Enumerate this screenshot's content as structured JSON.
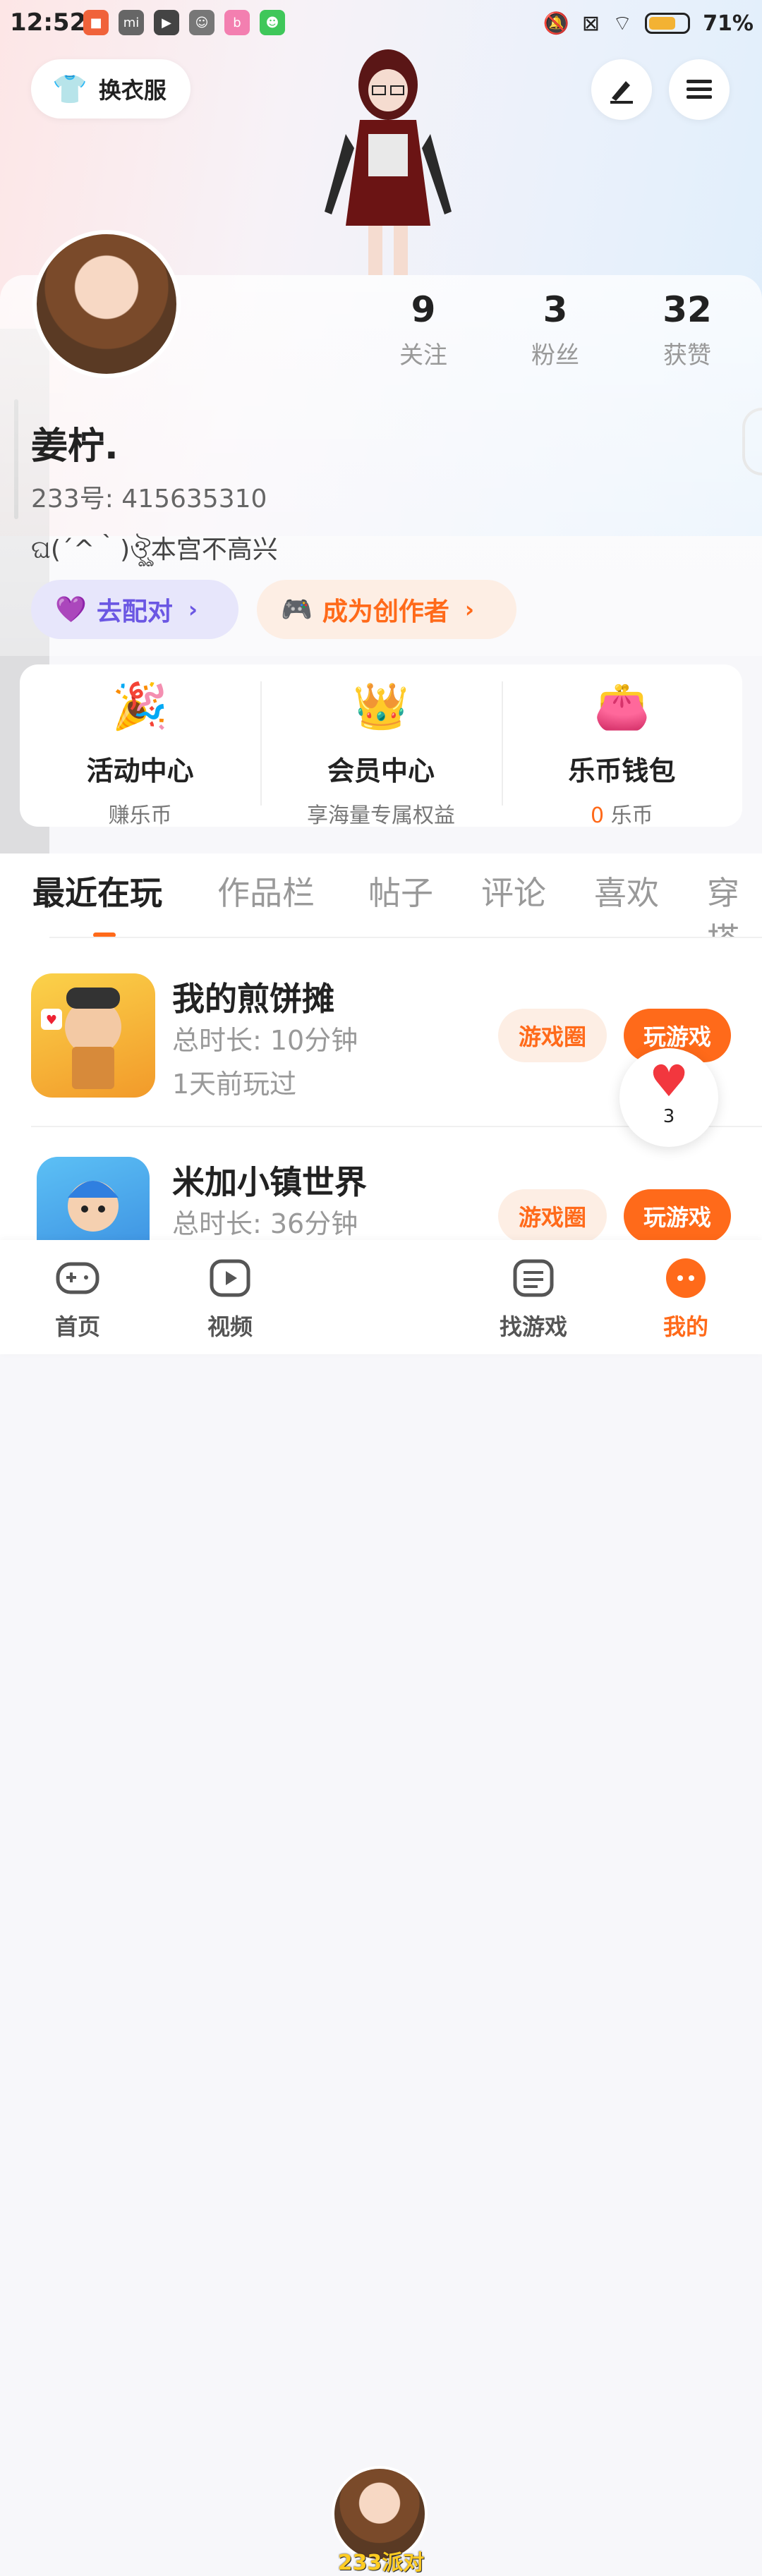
{
  "status_bar": {
    "time": "12:52",
    "battery": "71%",
    "battery_level": 0.71
  },
  "header": {
    "outfit_label": "换衣服",
    "edit_icon": "pen-icon",
    "menu_icon": "menu-icon"
  },
  "profile": {
    "username": "姜柠.",
    "id_text": "233号: 415635310",
    "signature": "ଘ(´^｀)ঔৣ本宫不高兴",
    "stats": [
      {
        "num": "9",
        "label": "关注"
      },
      {
        "num": "3",
        "label": "粉丝"
      },
      {
        "num": "32",
        "label": "获赞"
      }
    ],
    "pair_button": "去配对",
    "creator_button": "成为创作者"
  },
  "features": [
    {
      "title": "活动中心",
      "sub": "赚乐币",
      "icon": "party-popper-icon"
    },
    {
      "title": "会员中心",
      "sub": "享海量专属权益",
      "icon": "crown-icon"
    },
    {
      "title": "乐币钱包",
      "sub_accent": "0",
      "sub": " 乐币",
      "icon": "wallet-icon"
    }
  ],
  "tabs": [
    "最近在玩",
    "作品栏",
    "帖子",
    "评论",
    "喜欢",
    "穿搭"
  ],
  "active_tab": "最近在玩",
  "games": [
    {
      "name": "我的煎饼摊",
      "time": "总时长: 10分钟",
      "last": "1天前玩过",
      "circle_btn": "游戏圈",
      "play_btn": "玩游戏"
    },
    {
      "name": "米加小镇世界",
      "time": "总时长: 36分钟",
      "last": "",
      "circle_btn": "游戏圈",
      "play_btn": "玩游戏"
    }
  ],
  "like_float": {
    "count": "3"
  },
  "bottom_nav": [
    {
      "label": "首页",
      "icon": "gamepad-icon"
    },
    {
      "label": "视频",
      "icon": "play-icon"
    },
    {
      "label": "233派对",
      "icon": "avatar"
    },
    {
      "label": "找游戏",
      "icon": "list-icon"
    },
    {
      "label": "我的",
      "icon": "me-icon"
    }
  ],
  "colors": {
    "accent": "#ff6a1a",
    "purple": "#6b57e3"
  }
}
